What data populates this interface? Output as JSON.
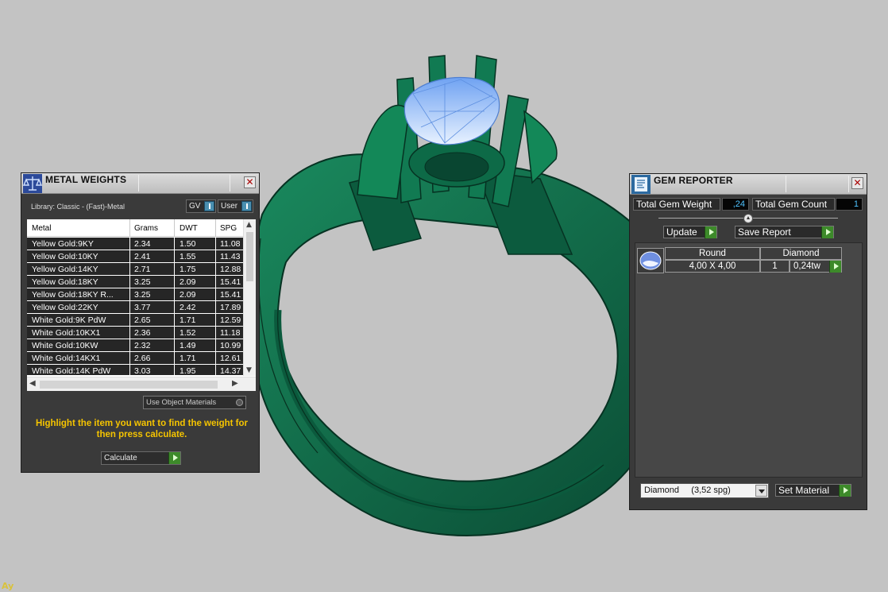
{
  "colors": {
    "viewport_bg": "#c3c3c3",
    "ring_green": "#0f6b4a",
    "gem_blue": "#8fb7f5",
    "hint_yellow": "#f5c400",
    "value_blue": "#4fc3ff"
  },
  "metal_weights": {
    "title": "METAL WEIGHTS",
    "icon": "scale-icon",
    "library": "Library: Classic - (Fast)-Metal",
    "gv_label": "GV",
    "user_label": "User",
    "columns": [
      "Metal",
      "Grams",
      "DWT",
      "SPG"
    ],
    "rows": [
      {
        "metal": "Yellow Gold:9KY",
        "grams": "2.34",
        "dwt": "1.50",
        "spg": "11.08"
      },
      {
        "metal": "Yellow Gold:10KY",
        "grams": "2.41",
        "dwt": "1.55",
        "spg": "11.43"
      },
      {
        "metal": "Yellow Gold:14KY",
        "grams": "2.71",
        "dwt": "1.75",
        "spg": "12.88"
      },
      {
        "metal": "Yellow Gold:18KY",
        "grams": "3.25",
        "dwt": "2.09",
        "spg": "15.41"
      },
      {
        "metal": "Yellow Gold:18KY R...",
        "grams": "3.25",
        "dwt": "2.09",
        "spg": "15.41"
      },
      {
        "metal": "Yellow Gold:22KY",
        "grams": "3.77",
        "dwt": "2.42",
        "spg": "17.89"
      },
      {
        "metal": "White Gold:9K PdW",
        "grams": "2.65",
        "dwt": "1.71",
        "spg": "12.59"
      },
      {
        "metal": "White Gold:10KX1",
        "grams": "2.36",
        "dwt": "1.52",
        "spg": "11.18"
      },
      {
        "metal": "White Gold:10KW",
        "grams": "2.32",
        "dwt": "1.49",
        "spg": "10.99"
      },
      {
        "metal": "White Gold:14KX1",
        "grams": "2.66",
        "dwt": "1.71",
        "spg": "12.61"
      },
      {
        "metal": "White Gold:14K PdW",
        "grams": "3.03",
        "dwt": "1.95",
        "spg": "14.37"
      }
    ],
    "use_object_materials": "Use Object Materials",
    "hint": "Highlight the item you want to find the weight for then press calculate.",
    "calculate_label": "Calculate"
  },
  "gem_reporter": {
    "title": "GEM REPORTER",
    "icon": "report-icon",
    "total_weight_label": "Total Gem Weight",
    "total_weight_value": ",24",
    "total_count_label": "Total Gem Count",
    "total_count_value": "1",
    "update_label": "Update",
    "save_report_label": "Save Report",
    "headers": [
      "Round",
      "Diamond"
    ],
    "gem": {
      "size": "4,00 X 4,00",
      "count": "1",
      "weight": "0,24tw"
    },
    "material_select": "Diamond     (3,52 spg)",
    "set_material_label": "Set Material"
  },
  "corner_logo": "Ay"
}
